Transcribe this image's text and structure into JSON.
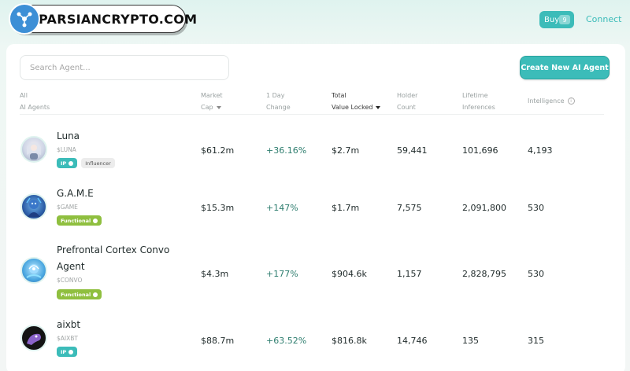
{
  "watermark": {
    "text": "PARSIANCRYPTO.COM"
  },
  "topbar": {
    "buy_label": "Buy",
    "buy_count": "9",
    "connect_label": "Connect"
  },
  "search": {
    "placeholder": "Search Agent..."
  },
  "create_button": {
    "label": "Create New AI Agent"
  },
  "columns": {
    "all": "All",
    "ai_agents": "AI Agents",
    "market": "Market",
    "cap": "Cap",
    "day": "1 Day",
    "change": "Change",
    "total": "Total",
    "tvl": "Value Locked",
    "holder": "Holder",
    "count": "Count",
    "lifetime": "Lifetime",
    "inferences": "Inferences",
    "intelligence": "Intelligence"
  },
  "agents": [
    {
      "name": "Luna",
      "name_line2": "",
      "ticker": "$LUNA",
      "badge1": "IP",
      "badge2": "Influencer",
      "market_cap": "$61.2m",
      "day_change": "+36.16%",
      "tvl": "$2.7m",
      "holders": "59,441",
      "inferences": "101,696",
      "intelligence": "4,193"
    },
    {
      "name": "G.A.M.E",
      "name_line2": "",
      "ticker": "$GAME",
      "badge1": "Functional",
      "badge2": "",
      "market_cap": "$15.3m",
      "day_change": "+147%",
      "tvl": "$1.7m",
      "holders": "7,575",
      "inferences": "2,091,800",
      "intelligence": "530"
    },
    {
      "name": "Prefrontal Cortex Convo",
      "name_line2": "Agent",
      "ticker": "$CONVO",
      "badge1": "Functional",
      "badge2": "",
      "market_cap": "$4.3m",
      "day_change": "+177%",
      "tvl": "$904.6k",
      "holders": "1,157",
      "inferences": "2,828,795",
      "intelligence": "530"
    },
    {
      "name": "aixbt",
      "name_line2": "",
      "ticker": "$AIXBT",
      "badge1": "IP",
      "badge2": "",
      "market_cap": "$88.7m",
      "day_change": "+63.52%",
      "tvl": "$816.8k",
      "holders": "14,746",
      "inferences": "135",
      "intelligence": "315"
    }
  ],
  "colors": {
    "accent": "#3cbcb9",
    "functional": "#8fbf3f",
    "positive": "#2d7d6e"
  }
}
